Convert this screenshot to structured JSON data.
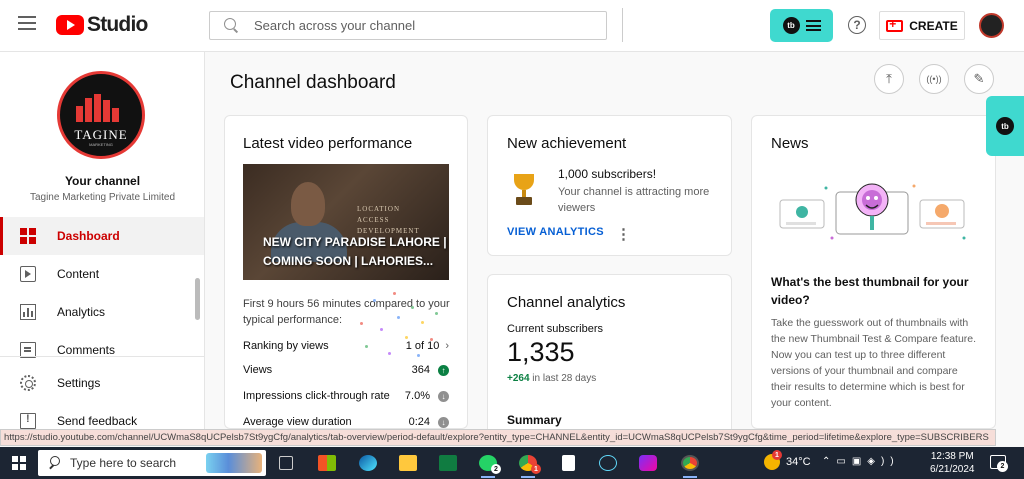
{
  "header": {
    "app_name": "Studio",
    "search_placeholder": "Search across your channel",
    "extension_badge": "tb",
    "help_glyph": "?",
    "create_label": "CREATE"
  },
  "sidebar": {
    "channel_logo_text": "TAGINE",
    "channel_logo_subtext": "MARKETING",
    "your_channel": "Your channel",
    "channel_name": "Tagine Marketing Private Limited",
    "items": [
      {
        "label": "Dashboard",
        "icon": "dashboard-icon",
        "active": true
      },
      {
        "label": "Content",
        "icon": "content-icon"
      },
      {
        "label": "Analytics",
        "icon": "analytics-icon"
      },
      {
        "label": "Comments",
        "icon": "comments-icon"
      }
    ],
    "bottom_items": [
      {
        "label": "Settings",
        "icon": "settings-icon"
      },
      {
        "label": "Send feedback",
        "icon": "feedback-icon"
      }
    ]
  },
  "main": {
    "title": "Channel dashboard",
    "actions": [
      {
        "name": "upload-icon",
        "glyph": "⤒"
      },
      {
        "name": "live-icon",
        "glyph": "((•))"
      },
      {
        "name": "edit-icon",
        "glyph": "✎"
      }
    ]
  },
  "latest_video": {
    "title": "Latest video performance",
    "thumbnail_caption": "NEW CITY PARADISE LAHORE | COMING SOON | LAHORIES...",
    "thumbnail_sign": "LOCATION\nACCESS\nDEVELOPMENT",
    "perf_text": "First 9 hours 56 minutes compared to your typical performance:",
    "stats": [
      {
        "label": "Ranking by views",
        "value": "1 of 10",
        "indicator": "chevron"
      },
      {
        "label": "Views",
        "value": "364",
        "indicator": "up"
      },
      {
        "label": "Impressions click-through rate",
        "value": "7.0%",
        "indicator": "down"
      },
      {
        "label": "Average view duration",
        "value": "0:24",
        "indicator": "down"
      }
    ]
  },
  "achievement": {
    "title": "New achievement",
    "headline": "1,000 subscribers!",
    "subtext": "Your channel is attracting more viewers",
    "link": "VIEW ANALYTICS",
    "menu_glyph": "⋮"
  },
  "channel_analytics": {
    "title": "Channel analytics",
    "subs_label": "Current subscribers",
    "subs_count": "1,335",
    "delta_value": "+264",
    "delta_text": " in last 28 days",
    "summary": "Summary"
  },
  "news": {
    "title": "News",
    "headline": "What's the best thumbnail for your video?",
    "body": "Take the guesswork out of thumbnails with the new Thumbnail Test & Compare feature. Now you can test up to three different versions of your thumbnail and compare their results to determine which is best for your content."
  },
  "status_url": "https://studio.youtube.com/channel/UCWmaS8qUCPelsb7St9ygCfg/analytics/tab-overview/period-default/explore?entity_type=CHANNEL&entity_id=UCWmaS8qUCPelsb7St9ygCfg&time_period=lifetime&explore_type=SUBSCRIBERS",
  "taskbar": {
    "search_placeholder": "Type here to search",
    "badges": {
      "whatsapp": "2",
      "chrome": "1"
    },
    "alert_badge": "1",
    "temperature": "34°C",
    "time": "12:38 PM",
    "date": "6/21/2024",
    "notifications": "2"
  },
  "colors": {
    "accent_red": "#cc0000",
    "extension_teal": "#3fd9cf",
    "link_blue": "#065fd4",
    "positive_green": "#0b8043"
  }
}
